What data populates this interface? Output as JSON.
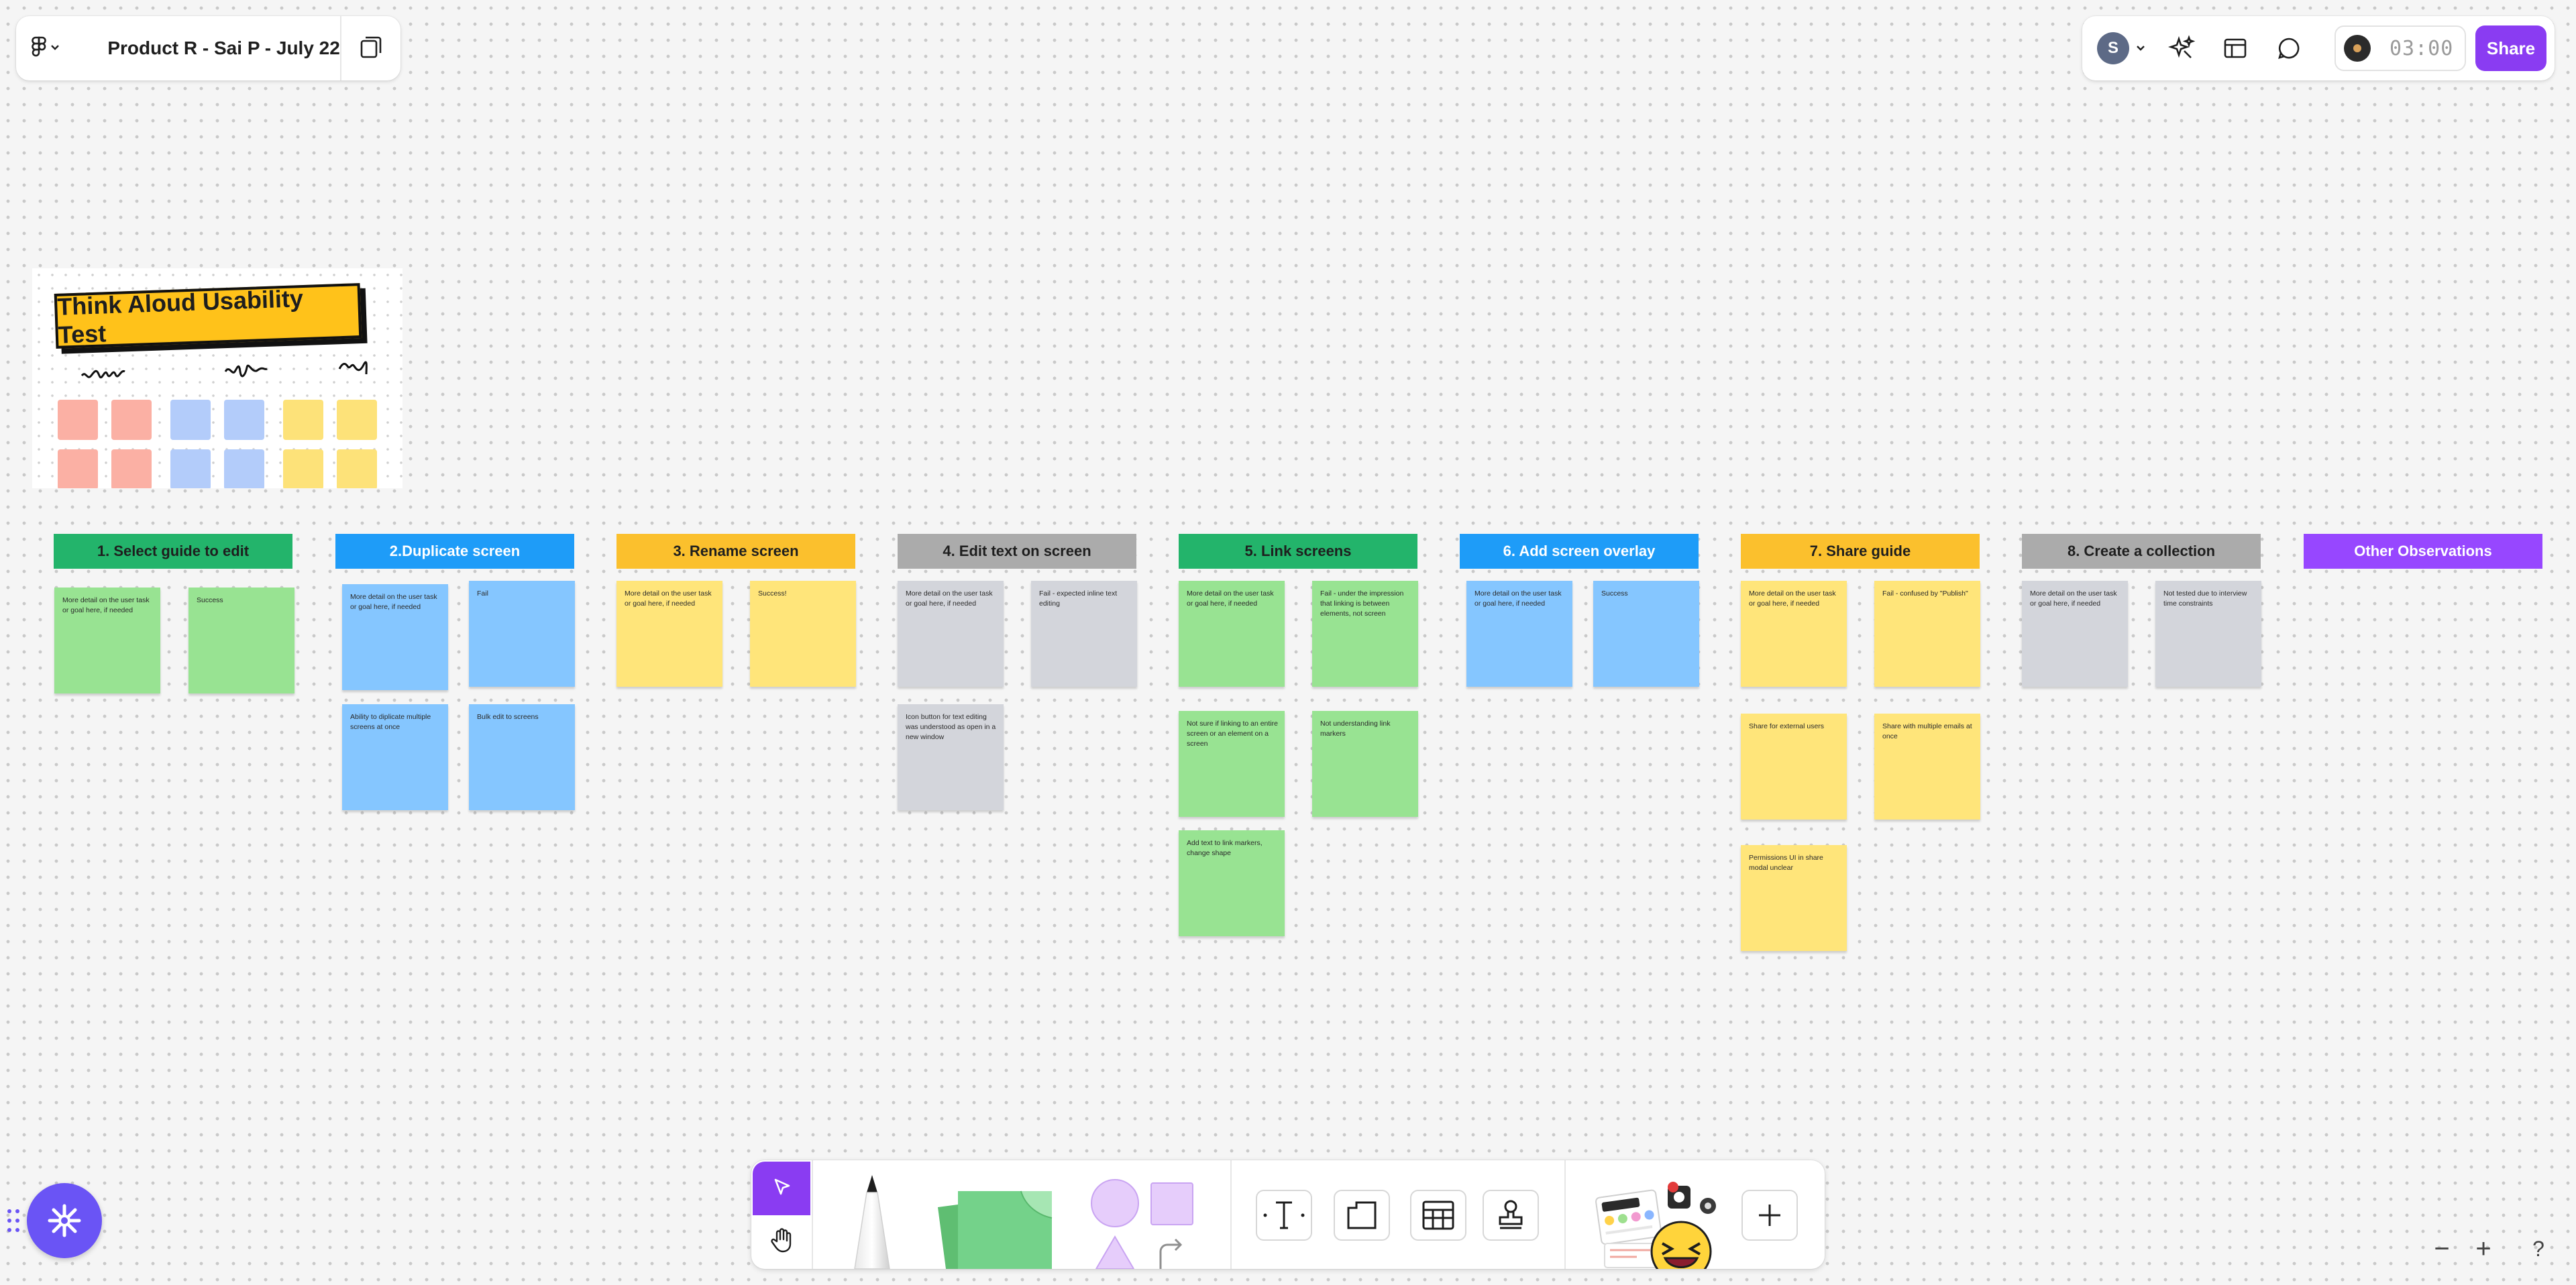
{
  "file": {
    "title": "Product R - Sai P - July 22",
    "menu_icon": "figma-logo-icon",
    "pages_icon": "pages-icon"
  },
  "header_right": {
    "avatar_initial": "S",
    "timer": "03:00",
    "share_label": "Share"
  },
  "cover": {
    "title": "Think Aloud Usability Test",
    "square_colors": [
      "#fbb0a4",
      "#b3ccfa",
      "#fde279"
    ]
  },
  "columns": [
    {
      "label": "1.  Select guide to edit",
      "color": "#23b46b",
      "notes": [
        {
          "text": "More detail on the user task or goal here, if needed",
          "color": "green"
        },
        {
          "text": "Success",
          "color": "green"
        }
      ]
    },
    {
      "label": "2.Duplicate screen",
      "color": "#1e9cf8",
      "notes": [
        {
          "text": "More detail on the user task or goal here, if needed",
          "color": "blue"
        },
        {
          "text": "Fail",
          "color": "blue"
        },
        {
          "text": "Ability to diplicate multiple screens at once",
          "color": "blue"
        },
        {
          "text": "Bulk edit to screens",
          "color": "blue"
        }
      ]
    },
    {
      "label": "3. Rename screen",
      "color": "#fbc02d",
      "notes": [
        {
          "text": "More detail on the user task or goal here, if needed",
          "color": "yellow"
        },
        {
          "text": "Success!",
          "color": "yellow"
        }
      ]
    },
    {
      "label": "4. Edit text on screen",
      "color": "#ababab",
      "notes": [
        {
          "text": "More detail on the user task or goal here, if needed",
          "color": "gray"
        },
        {
          "text": "Fail - expected inline text editing",
          "color": "gray"
        },
        {
          "text": "Icon button for text editing was understood as open in a new window",
          "color": "gray"
        }
      ]
    },
    {
      "label": "5. Link screens",
      "color": "#23b46b",
      "notes": [
        {
          "text": "More detail on the user task or goal here, if needed",
          "color": "green"
        },
        {
          "text": "Fail - under the impression that linking is between elements, not screen",
          "color": "green"
        },
        {
          "text": "Not sure if linking to an entire screen or an element on a screen",
          "color": "green"
        },
        {
          "text": "Not understanding link markers",
          "color": "green"
        },
        {
          "text": "Add text to link markers, change shape",
          "color": "green"
        }
      ]
    },
    {
      "label": "6. Add screen overlay",
      "color": "#1e9cf8",
      "notes": [
        {
          "text": "More detail on the user task or goal here, if needed",
          "color": "blue"
        },
        {
          "text": "Success",
          "color": "blue"
        }
      ]
    },
    {
      "label": "7. Share guide",
      "color": "#fbc02d",
      "notes": [
        {
          "text": "More detail on the user task or goal here, if needed",
          "color": "yellow"
        },
        {
          "text": "Fail - confused by \"Publish\"",
          "color": "yellow"
        },
        {
          "text": "Share for external users",
          "color": "yellow"
        },
        {
          "text": "Share with multiple emails at once",
          "color": "yellow"
        },
        {
          "text": "Permissions UI in share modal unclear",
          "color": "yellow"
        }
      ]
    },
    {
      "label": "8. Create a collection",
      "color": "#ababab",
      "notes": [
        {
          "text": "More detail on the user task or goal here, if needed",
          "color": "gray"
        },
        {
          "text": "Not tested due to interview time constraints",
          "color": "gray"
        }
      ]
    },
    {
      "label": "Other Observations",
      "color": "#9747ff",
      "notes": []
    }
  ],
  "toolbar": {
    "tools": [
      "move-tool",
      "hand-tool",
      "marker-tool",
      "sticky-note-tool",
      "circle-shape",
      "square-shape",
      "triangle-shape",
      "connector-tool",
      "text-tool",
      "section-tool",
      "table-tool",
      "stamp-tool",
      "widgets-tool",
      "add-tool"
    ]
  },
  "zoom": {
    "minus": "−",
    "plus": "+",
    "help": "?"
  }
}
